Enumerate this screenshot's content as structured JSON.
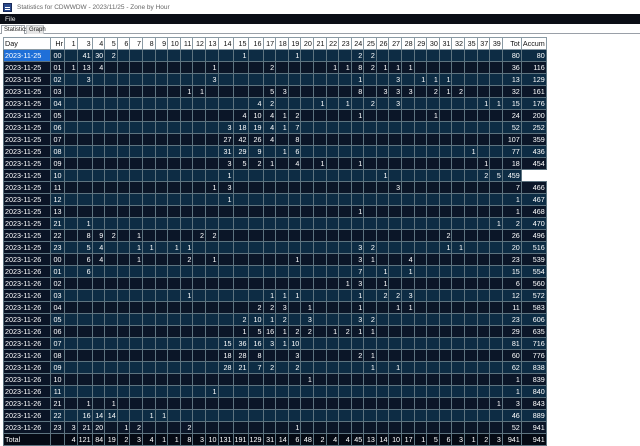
{
  "window": {
    "title": "Statistics for CDWWDW - 2023/11/25 - Zone by Hour"
  },
  "menu": {
    "file": "File"
  },
  "tabs": [
    "Statistics",
    "Graph"
  ],
  "table": {
    "headers": [
      "Day",
      "Hr",
      "1",
      "3",
      "4",
      "5",
      "6",
      "7",
      "8",
      "9",
      "10",
      "11",
      "12",
      "13",
      "14",
      "15",
      "16",
      "17",
      "18",
      "19",
      "20",
      "21",
      "22",
      "23",
      "24",
      "25",
      "26",
      "27",
      "28",
      "29",
      "30",
      "31",
      "32",
      "35",
      "37",
      "39",
      "Tot",
      "Accum"
    ],
    "rows": [
      [
        "2023-11-25",
        "00",
        "",
        "41",
        "30",
        "2",
        "",
        "",
        "",
        "",
        "",
        "",
        "",
        "",
        "",
        "1",
        "",
        "",
        "",
        "1",
        "",
        "",
        "",
        "",
        "2",
        "2",
        "",
        "",
        "",
        "",
        "",
        "",
        "",
        "",
        "",
        "",
        "80",
        "80"
      ],
      [
        "2023-11-25",
        "01",
        "1",
        "13",
        "4",
        "",
        "",
        "",
        "",
        "",
        "",
        "",
        "",
        "1",
        "",
        "",
        "",
        "2",
        "",
        "",
        "",
        "",
        "1",
        "1",
        "8",
        "2",
        "1",
        "1",
        "1",
        "",
        "",
        "",
        "",
        "",
        "",
        "",
        "36",
        "116"
      ],
      [
        "2023-11-25",
        "02",
        "",
        "3",
        "",
        "",
        "",
        "",
        "",
        "",
        "",
        "",
        "",
        "3",
        "",
        "",
        "",
        "",
        "",
        "",
        "",
        "",
        "",
        "",
        "1",
        "",
        "",
        "3",
        "",
        "1",
        "1",
        "1",
        "",
        "",
        "",
        "",
        "13",
        "129"
      ],
      [
        "2023-11-25",
        "03",
        "",
        "",
        "",
        "",
        "",
        "",
        "",
        "",
        "",
        "1",
        "1",
        "",
        "",
        "",
        "",
        "5",
        "3",
        "",
        "",
        "",
        "",
        "",
        "8",
        "",
        "3",
        "3",
        "3",
        "",
        "2",
        "1",
        "2",
        "",
        "",
        "",
        "32",
        "161"
      ],
      [
        "2023-11-25",
        "04",
        "",
        "",
        "",
        "",
        "",
        "",
        "",
        "",
        "",
        "",
        "",
        "",
        "",
        "",
        "4",
        "2",
        "",
        "",
        "",
        "1",
        "",
        "1",
        "",
        "2",
        "",
        "3",
        "",
        "",
        "",
        "",
        "",
        "",
        "1",
        "1",
        "15",
        "176"
      ],
      [
        "2023-11-25",
        "05",
        "",
        "",
        "",
        "",
        "",
        "",
        "",
        "",
        "",
        "",
        "",
        "",
        "",
        "4",
        "10",
        "4",
        "1",
        "2",
        "",
        "",
        "",
        "",
        "1",
        "",
        "",
        "",
        "",
        "",
        "1",
        "",
        "",
        "",
        "",
        "",
        "24",
        "200"
      ],
      [
        "2023-11-25",
        "06",
        "",
        "",
        "",
        "",
        "",
        "",
        "",
        "",
        "",
        "",
        "",
        "",
        "3",
        "18",
        "19",
        "4",
        "1",
        "7",
        "",
        "",
        "",
        "",
        "",
        "",
        "",
        "",
        "",
        "",
        "",
        "",
        "",
        "",
        "",
        "",
        "52",
        "252"
      ],
      [
        "2023-11-25",
        "07",
        "",
        "",
        "",
        "",
        "",
        "",
        "",
        "",
        "",
        "",
        "",
        "",
        "27",
        "42",
        "26",
        "4",
        "",
        "8",
        "",
        "",
        "",
        "",
        "",
        "",
        "",
        "",
        "",
        "",
        "",
        "",
        "",
        "",
        "",
        "",
        "107",
        "359"
      ],
      [
        "2023-11-25",
        "08",
        "",
        "",
        "",
        "",
        "",
        "",
        "",
        "",
        "",
        "",
        "",
        "",
        "31",
        "29",
        "9",
        "",
        "1",
        "6",
        "",
        "",
        "",
        "",
        "",
        "",
        "",
        "",
        "",
        "",
        "",
        "",
        "",
        "1",
        "",
        "",
        "77",
        "436"
      ],
      [
        "2023-11-25",
        "09",
        "",
        "",
        "",
        "",
        "",
        "",
        "",
        "",
        "",
        "",
        "",
        "",
        "3",
        "5",
        "2",
        "1",
        "",
        "4",
        "",
        "1",
        "",
        "",
        "1",
        "",
        "",
        "",
        "",
        "",
        "",
        "",
        "",
        "",
        "1",
        "",
        "18",
        "454"
      ],
      [
        "2023-11-25",
        "10",
        "",
        "",
        "",
        "",
        "",
        "",
        "",
        "",
        "",
        "",
        "",
        "",
        "1",
        "",
        "",
        "",
        "",
        "",
        "",
        "",
        "",
        "",
        "",
        "",
        "1",
        "",
        "",
        "",
        "",
        "",
        "",
        "",
        "2",
        "5",
        "459"
      ],
      [
        "2023-11-25",
        "11",
        "",
        "",
        "",
        "",
        "",
        "",
        "",
        "",
        "",
        "",
        "",
        "1",
        "3",
        "",
        "",
        "",
        "",
        "",
        "",
        "",
        "",
        "",
        "",
        "",
        "",
        "3",
        "",
        "",
        "",
        "",
        "",
        "",
        "",
        "",
        "7",
        "466"
      ],
      [
        "2023-11-25",
        "12",
        "",
        "",
        "",
        "",
        "",
        "",
        "",
        "",
        "",
        "",
        "",
        "",
        "1",
        "",
        "",
        "",
        "",
        "",
        "",
        "",
        "",
        "",
        "",
        "",
        "",
        "",
        "",
        "",
        "",
        "",
        "",
        "",
        "",
        "",
        "1",
        "467"
      ],
      [
        "2023-11-25",
        "13",
        "",
        "",
        "",
        "",
        "",
        "",
        "",
        "",
        "",
        "",
        "",
        "",
        "",
        "",
        "",
        "",
        "",
        "",
        "",
        "",
        "",
        "",
        "1",
        "",
        "",
        "",
        "",
        "",
        "",
        "",
        "",
        "",
        "",
        "",
        "1",
        "468"
      ],
      [
        "2023-11-25",
        "21",
        "",
        "1",
        "",
        "",
        "",
        "",
        "",
        "",
        "",
        "",
        "",
        "",
        "",
        "",
        "",
        "",
        "",
        "",
        "",
        "",
        "",
        "",
        "",
        "",
        "",
        "",
        "",
        "",
        "",
        "",
        "",
        "",
        "",
        "1",
        "2",
        "470"
      ],
      [
        "2023-11-25",
        "22",
        "",
        "8",
        "9",
        "2",
        "",
        "1",
        "",
        "",
        "",
        "",
        "2",
        "2",
        "",
        "",
        "",
        "",
        "",
        "",
        "",
        "",
        "",
        "",
        "",
        "",
        "",
        "",
        "",
        "",
        "",
        "2",
        "",
        "",
        "",
        "",
        "26",
        "496"
      ],
      [
        "2023-11-25",
        "23",
        "",
        "5",
        "4",
        "",
        "",
        "1",
        "1",
        "",
        "1",
        "1",
        "",
        "",
        "",
        "",
        "",
        "",
        "",
        "",
        "",
        "",
        "",
        "",
        "3",
        "2",
        "",
        "",
        "",
        "",
        "",
        "1",
        "1",
        "",
        "",
        "",
        "20",
        "516"
      ],
      [
        "2023-11-26",
        "00",
        "",
        "6",
        "4",
        "",
        "",
        "1",
        "",
        "",
        "",
        "2",
        "",
        "1",
        "",
        "",
        "",
        "",
        "",
        "1",
        "",
        "",
        "",
        "",
        "3",
        "1",
        "",
        "",
        "4",
        "",
        "",
        "",
        "",
        "",
        "",
        "",
        "23",
        "539"
      ],
      [
        "2023-11-26",
        "01",
        "",
        "6",
        "",
        "",
        "",
        "",
        "",
        "",
        "",
        "",
        "",
        "",
        "",
        "",
        "",
        "",
        "",
        "",
        "",
        "",
        "",
        "",
        "7",
        "",
        "1",
        "",
        "1",
        "",
        "",
        "",
        "",
        "",
        "",
        "",
        "15",
        "554"
      ],
      [
        "2023-11-26",
        "02",
        "",
        "",
        "",
        "",
        "",
        "",
        "",
        "",
        "",
        "",
        "",
        "",
        "",
        "",
        "",
        "",
        "",
        "",
        "",
        "",
        "",
        "1",
        "3",
        "",
        "1",
        "",
        "",
        "",
        "",
        "",
        "",
        "",
        "",
        "",
        "6",
        "560"
      ],
      [
        "2023-11-26",
        "03",
        "",
        "",
        "",
        "",
        "",
        "",
        "",
        "",
        "",
        "1",
        "",
        "",
        "",
        "",
        "",
        "1",
        "1",
        "1",
        "",
        "",
        "",
        "",
        "1",
        "",
        "2",
        "2",
        "3",
        "",
        "",
        "",
        "",
        "",
        "",
        "",
        "12",
        "572"
      ],
      [
        "2023-11-26",
        "04",
        "",
        "",
        "",
        "",
        "",
        "",
        "",
        "",
        "",
        "",
        "",
        "",
        "",
        "",
        "2",
        "2",
        "3",
        "",
        "1",
        "",
        "",
        "",
        "1",
        "",
        "",
        "1",
        "1",
        "",
        "",
        "",
        "",
        "",
        "",
        "",
        "11",
        "583"
      ],
      [
        "2023-11-26",
        "05",
        "",
        "",
        "",
        "",
        "",
        "",
        "",
        "",
        "",
        "",
        "",
        "",
        "",
        "2",
        "10",
        "1",
        "2",
        "",
        "3",
        "",
        "",
        "",
        "3",
        "2",
        "",
        "",
        "",
        "",
        "",
        "",
        "",
        "",
        "",
        "",
        "23",
        "606"
      ],
      [
        "2023-11-26",
        "06",
        "",
        "",
        "",
        "",
        "",
        "",
        "",
        "",
        "",
        "",
        "",
        "",
        "",
        "1",
        "5",
        "16",
        "1",
        "2",
        "2",
        "",
        "1",
        "2",
        "1",
        "1",
        "",
        "",
        "",
        "",
        "",
        "",
        "",
        "",
        "",
        "",
        "29",
        "635"
      ],
      [
        "2023-11-26",
        "07",
        "",
        "",
        "",
        "",
        "",
        "",
        "",
        "",
        "",
        "",
        "",
        "",
        "15",
        "36",
        "16",
        "3",
        "1",
        "10",
        "",
        "",
        "",
        "",
        "",
        "",
        "",
        "",
        "",
        "",
        "",
        "",
        "",
        "",
        "",
        "",
        "81",
        "716"
      ],
      [
        "2023-11-26",
        "08",
        "",
        "",
        "",
        "",
        "",
        "",
        "",
        "",
        "",
        "",
        "",
        "",
        "18",
        "28",
        "8",
        "",
        "",
        "3",
        "",
        "",
        "",
        "",
        "2",
        "1",
        "",
        "",
        "",
        "",
        "",
        "",
        "",
        "",
        "",
        "",
        "60",
        "776"
      ],
      [
        "2023-11-26",
        "09",
        "",
        "",
        "",
        "",
        "",
        "",
        "",
        "",
        "",
        "",
        "",
        "",
        "28",
        "21",
        "7",
        "2",
        "",
        "2",
        "",
        "",
        "",
        "",
        "",
        "1",
        "",
        "1",
        "",
        "",
        "",
        "",
        "",
        "",
        "",
        "",
        "62",
        "838"
      ],
      [
        "2023-11-26",
        "10",
        "",
        "",
        "",
        "",
        "",
        "",
        "",
        "",
        "",
        "",
        "",
        "",
        "",
        "",
        "",
        "",
        "",
        "",
        "1",
        "",
        "",
        "",
        "",
        "",
        "",
        "",
        "",
        "",
        "",
        "",
        "",
        "",
        "",
        "",
        "1",
        "839"
      ],
      [
        "2023-11-26",
        "11",
        "",
        "",
        "",
        "",
        "",
        "",
        "",
        "",
        "",
        "",
        "",
        "1",
        "",
        "",
        "",
        "",
        "",
        "",
        "",
        "",
        "",
        "",
        "",
        "",
        "",
        "",
        "",
        "",
        "",
        "",
        "",
        "",
        "",
        "",
        "1",
        "840"
      ],
      [
        "2023-11-26",
        "21",
        "",
        "1",
        "",
        "1",
        "",
        "",
        "",
        "",
        "",
        "",
        "",
        "",
        "",
        "",
        "",
        "",
        "",
        "",
        "",
        "",
        "",
        "",
        "",
        "",
        "",
        "",
        "",
        "",
        "",
        "",
        "",
        "",
        "",
        "1",
        "3",
        "843"
      ],
      [
        "2023-11-26",
        "22",
        "",
        "16",
        "14",
        "14",
        "",
        "",
        "1",
        "1",
        "",
        "",
        "",
        "",
        "",
        "",
        "",
        "",
        "",
        "",
        "",
        "",
        "",
        "",
        "",
        "",
        "",
        "",
        "",
        "",
        "",
        "",
        "",
        "",
        "",
        "",
        "46",
        "889"
      ],
      [
        "2023-11-26",
        "23",
        "3",
        "21",
        "20",
        "",
        "1",
        "2",
        "",
        "",
        "",
        "2",
        "",
        "",
        "",
        "",
        "",
        "",
        "",
        "1",
        "",
        "",
        "",
        "",
        "",
        "",
        "",
        "",
        "",
        "",
        "",
        "",
        "",
        "",
        "",
        "",
        "52",
        "941"
      ]
    ],
    "totals": [
      "Total",
      "",
      "4",
      "121",
      "84",
      "19",
      "2",
      "3",
      "4",
      "1",
      "1",
      "8",
      "3",
      "10",
      "131",
      "191",
      "129",
      "31",
      "14",
      "6",
      "48",
      "2",
      "4",
      "4",
      "45",
      "13",
      "14",
      "10",
      "17",
      "1",
      "5",
      "6",
      "3",
      "1",
      "2",
      "3",
      "941",
      "941"
    ]
  },
  "colors": {
    "selected_day": "#1f6fd8",
    "row_even": "#0d2c44",
    "row_odd": "#0b1628",
    "menubar": "#0b0e16"
  }
}
